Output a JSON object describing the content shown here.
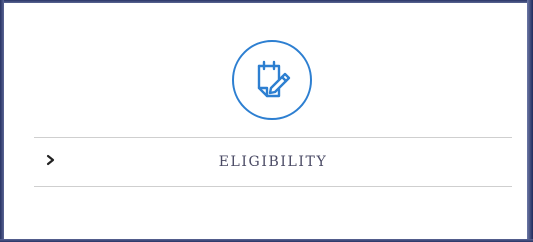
{
  "colors": {
    "accent": "#2d7fd1",
    "label_text": "#4a4a64",
    "divider": "#cfcfcf",
    "frame": "#2a3566"
  },
  "icon": {
    "name": "notepad-pencil-icon"
  },
  "accordion": {
    "items": [
      {
        "label": "ELIGIBILITY",
        "expanded": false,
        "chevron": "chevron-right-icon"
      }
    ]
  }
}
